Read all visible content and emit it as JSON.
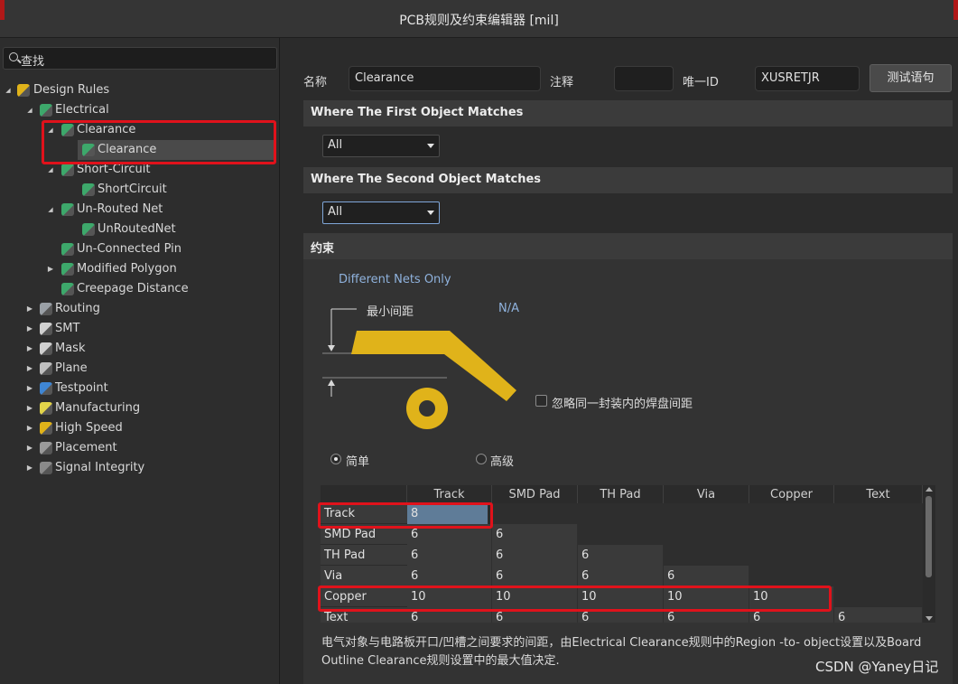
{
  "window": {
    "title": "PCB规则及约束编辑器 [mil]"
  },
  "left_panel": {
    "search_placeholder": "查找",
    "tree": [
      {
        "label": "Design Rules",
        "icon": "design-rules-icon",
        "expanded": true
      },
      {
        "label": "Electrical",
        "icon": "electrical-rule-icon",
        "expanded": true
      },
      {
        "label": "Clearance",
        "icon": "rule-category-icon",
        "expanded": true
      },
      {
        "label": "Clearance",
        "icon": "rule-icon",
        "selected": true
      },
      {
        "label": "Short-Circuit",
        "icon": "rule-category-icon",
        "expanded": true
      },
      {
        "label": "ShortCircuit",
        "icon": "rule-icon"
      },
      {
        "label": "Un-Routed Net",
        "icon": "rule-category-icon",
        "expanded": true
      },
      {
        "label": "UnRoutedNet",
        "icon": "rule-icon"
      },
      {
        "label": "Un-Connected Pin",
        "icon": "rule-category-icon"
      },
      {
        "label": "Modified Polygon",
        "icon": "rule-category-icon",
        "expanded": false
      },
      {
        "label": "Creepage Distance",
        "icon": "rule-category-icon"
      },
      {
        "label": "Routing",
        "icon": "routing-icon",
        "expanded": false
      },
      {
        "label": "SMT",
        "icon": "smt-icon",
        "expanded": false
      },
      {
        "label": "Mask",
        "icon": "mask-icon",
        "expanded": false
      },
      {
        "label": "Plane",
        "icon": "plane-icon",
        "expanded": false
      },
      {
        "label": "Testpoint",
        "icon": "testpoint-icon",
        "expanded": false
      },
      {
        "label": "Manufacturing",
        "icon": "manufacturing-icon",
        "expanded": false
      },
      {
        "label": "High Speed",
        "icon": "high-speed-icon",
        "expanded": false
      },
      {
        "label": "Placement",
        "icon": "placement-icon",
        "expanded": false
      },
      {
        "label": "Signal Integrity",
        "icon": "signal-integrity-icon",
        "expanded": false
      }
    ]
  },
  "rule_header": {
    "name_label": "名称",
    "name_value": "Clearance",
    "comment_label": "注释",
    "comment_value": "",
    "uid_label": "唯一ID",
    "uid_value": "XUSRETJR",
    "test_button": "测试语句"
  },
  "first_object": {
    "heading": "Where The First Object Matches",
    "selected": "All"
  },
  "second_object": {
    "heading": "Where The Second Object Matches",
    "selected": "All"
  },
  "constraints": {
    "heading": "约束",
    "net_scope": "Different Nets Only",
    "min_clearance_label": "最小间距",
    "min_clearance_value": "N/A",
    "ignore_pad_label": "忽略同一封装内的焊盘间距",
    "ignore_pad_checked": false,
    "mode_simple": "简单",
    "mode_advanced": "高级",
    "mode_selected": "simple",
    "colors": {
      "copper_graphic": "#e0b31a",
      "highlight": "#e0121b"
    }
  },
  "matrix": {
    "columns": [
      "Track",
      "SMD Pad",
      "TH Pad",
      "Via",
      "Copper",
      "Text"
    ],
    "rows": [
      {
        "label": "Track",
        "values": [
          "8"
        ]
      },
      {
        "label": "SMD Pad",
        "values": [
          "6",
          "6"
        ]
      },
      {
        "label": "TH Pad",
        "values": [
          "6",
          "6",
          "6"
        ]
      },
      {
        "label": "Via",
        "values": [
          "6",
          "6",
          "6",
          "6"
        ]
      },
      {
        "label": "Copper",
        "values": [
          "10",
          "10",
          "10",
          "10",
          "10"
        ]
      },
      {
        "label": "Text",
        "values": [
          "6",
          "6",
          "6",
          "6",
          "6",
          "6"
        ]
      }
    ]
  },
  "description": "电气对象与电路板开口/凹槽之间要求的间距，由Electrical Clearance规则中的Region -to- object设置以及Board Outline Clearance规则设置中的最大值决定.",
  "watermark": "CSDN @Yaney日记"
}
